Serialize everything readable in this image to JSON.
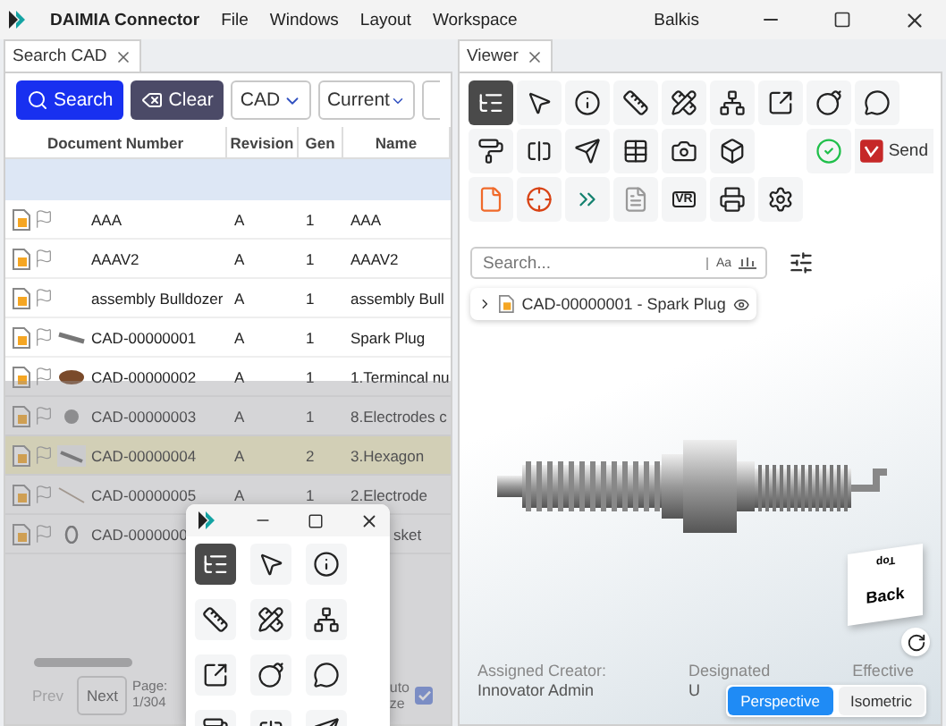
{
  "titlebar": {
    "app_name": "DAIMIA Connector",
    "menu": [
      "File",
      "Windows",
      "Layout",
      "Workspace"
    ],
    "user": "Balkis"
  },
  "search_panel": {
    "tab": "Search CAD",
    "search_button": "Search",
    "clear_button": "Clear",
    "type_select": "CAD",
    "revision_select": "Current",
    "columns": [
      "Document Number",
      "Revision",
      "Gen",
      "Name"
    ],
    "rows": [
      {
        "document_number": "AAA",
        "revision": "A",
        "gen": "1",
        "name": "AAA",
        "selected": false
      },
      {
        "document_number": "AAAV2",
        "revision": "A",
        "gen": "1",
        "name": "AAAV2",
        "selected": false
      },
      {
        "document_number": "assembly Bulldozer",
        "revision": "A",
        "gen": "1",
        "name": "assembly Bull",
        "selected": false
      },
      {
        "document_number": "CAD-00000001",
        "revision": "A",
        "gen": "1",
        "name": "Spark Plug",
        "selected": false
      },
      {
        "document_number": "CAD-00000002",
        "revision": "A",
        "gen": "1",
        "name": "1.Termincal nu",
        "selected": false
      },
      {
        "document_number": "CAD-00000003",
        "revision": "A",
        "gen": "1",
        "name": "8.Electrodes c",
        "selected": false
      },
      {
        "document_number": "CAD-00000004",
        "revision": "A",
        "gen": "2",
        "name": "3.Hexagon",
        "selected": true
      },
      {
        "document_number": "CAD-00000005",
        "revision": "A",
        "gen": "1",
        "name": "2.Electrode",
        "selected": false
      },
      {
        "document_number": "CAD-0000000",
        "name": "sket",
        "selected": false
      }
    ],
    "prev_button": {
      "label": "Prev",
      "disabled": true
    },
    "next_button": {
      "label": "Next",
      "disabled": false
    },
    "page_label": "Page:",
    "page_value": "1/304",
    "auto_size": {
      "label_lines": [
        "uto",
        "ze"
      ],
      "checked": true
    }
  },
  "viewer": {
    "tab": "Viewer",
    "tools": [
      {
        "selected": true
      },
      {
        "selected": false
      },
      {
        "selected": false
      },
      {
        "selected": false
      },
      {
        "selected": false
      },
      {
        "selected": false
      },
      {
        "selected": false
      },
      {
        "selected": false
      },
      {
        "selected": false
      },
      {
        "selected": false
      },
      {
        "selected": false
      },
      {
        "selected": false
      },
      {
        "selected": false
      },
      {
        "selected": false
      },
      {
        "selected": false
      },
      {
        "selected": false
      },
      {
        "selected": false
      },
      {
        "selected": false
      },
      {
        "selected": false
      },
      {
        "selected": false
      },
      {
        "selected": false,
        "label": "VR"
      },
      {
        "selected": false
      },
      {
        "selected": false
      }
    ],
    "send_button": "Send",
    "search": {
      "placeholder": "Search...",
      "case_toggle": "Aa"
    },
    "tree_item": {
      "document_number": "CAD-00000001",
      "separator": "-",
      "name": "Spark Plug",
      "expanded": false
    },
    "view_cube": {
      "top": "Top",
      "front": "Back"
    },
    "info": [
      {
        "label": "Assigned Creator:",
        "value": "Innovator Admin"
      },
      {
        "label": "Designated",
        "value": "U"
      },
      {
        "label": "Effective"
      }
    ],
    "projection": [
      {
        "label": "Perspective",
        "selected": true
      },
      {
        "label": "Isometric",
        "selected": false
      }
    ]
  },
  "floating_toolbar": {
    "tools": [
      {
        "selected": true
      },
      {
        "selected": false
      },
      {
        "selected": false
      },
      {
        "selected": false
      },
      {
        "selected": false
      },
      {
        "selected": false
      },
      {
        "selected": false
      },
      {
        "selected": false
      },
      {
        "selected": false
      },
      {
        "selected": false
      },
      {
        "selected": false
      },
      {
        "selected": false
      }
    ]
  }
}
